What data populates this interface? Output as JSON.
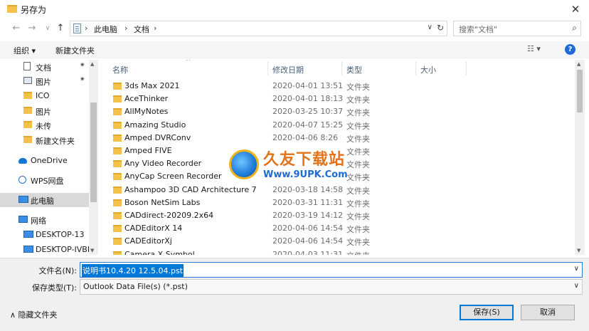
{
  "window": {
    "title": "另存为",
    "close_glyph": "✕"
  },
  "nav": {
    "back_glyph": "←",
    "forward_glyph": "→",
    "recent_glyph": "∨",
    "up_glyph": "↑"
  },
  "address": {
    "crumbs": [
      "此电脑",
      "文档"
    ],
    "sep_glyph": "›",
    "dropdown_glyph": "∨",
    "refresh_glyph": "↻"
  },
  "search": {
    "placeholder": "搜索\"文档\"",
    "icon_glyph": "⌕"
  },
  "toolbar": {
    "organize_label": "组织 ▾",
    "new_folder_label": "新建文件夹",
    "view_label": "☷ ▾",
    "help_label": "?"
  },
  "sidebar": {
    "items": [
      {
        "label": "文档",
        "icon": "document-icon",
        "pinned": true
      },
      {
        "label": "图片",
        "icon": "pictures-icon",
        "pinned": true
      },
      {
        "label": "ICO",
        "icon": "folder-icon",
        "pinned": false
      },
      {
        "label": "图片",
        "icon": "folder-icon",
        "pinned": false
      },
      {
        "label": "未传",
        "icon": "folder-icon",
        "pinned": false
      },
      {
        "label": "新建文件夹",
        "icon": "folder-icon",
        "pinned": false
      },
      {
        "label": "OneDrive",
        "icon": "cloud-icon",
        "pinned": false
      },
      {
        "label": "WPS网盘",
        "icon": "wps-cloud-icon",
        "pinned": false
      },
      {
        "label": "此电脑",
        "icon": "computer-icon",
        "pinned": false,
        "selected": true
      },
      {
        "label": "网络",
        "icon": "network-icon",
        "pinned": false
      },
      {
        "label": "DESKTOP-13",
        "icon": "computer-icon",
        "pinned": false
      },
      {
        "label": "DESKTOP-IVBL",
        "icon": "computer-icon",
        "pinned": false
      }
    ],
    "pin_glyph": "📌"
  },
  "columns": {
    "name": "名称",
    "modified": "修改日期",
    "type": "类型",
    "size": "大小",
    "sort_glyph": "^"
  },
  "files": [
    {
      "name": "3ds Max 2021",
      "date": "2020-04-01 13:51",
      "type": "文件夹"
    },
    {
      "name": "AceThinker",
      "date": "2020-04-01 18:13",
      "type": "文件夹"
    },
    {
      "name": "AllMyNotes",
      "date": "2020-03-25 10:37",
      "type": "文件夹"
    },
    {
      "name": "Amazing Studio",
      "date": "2020-04-07 15:25",
      "type": "文件夹"
    },
    {
      "name": "Amped DVRConv",
      "date": "2020-04-06 8:26",
      "type": "文件夹"
    },
    {
      "name": "Amped FIVE",
      "date": "",
      "type": "文件夹"
    },
    {
      "name": "Any Video Recorder",
      "date": "",
      "type": "文件夹"
    },
    {
      "name": "AnyCap Screen Recorder",
      "date": "",
      "type": "文件夹"
    },
    {
      "name": "Ashampoo 3D CAD Architecture 7",
      "date": "2020-03-18 14:58",
      "type": "文件夹"
    },
    {
      "name": "Boson NetSim Labs",
      "date": "2020-03-31 11:31",
      "type": "文件夹"
    },
    {
      "name": "CADdirect-20209.2x64",
      "date": "2020-03-19 14:12",
      "type": "文件夹"
    },
    {
      "name": "CADEditorX 14",
      "date": "2020-04-06 14:54",
      "type": "文件夹"
    },
    {
      "name": "CADEditorXj",
      "date": "2020-04-06 14:54",
      "type": "文件夹"
    },
    {
      "name": "Camera X Symbol",
      "date": "2020-04-03 11:31",
      "type": "文件夹"
    }
  ],
  "watermark": {
    "title": "久友下载站",
    "url": "Www.9UPK.Com",
    "faint": "WWW．9UPK．COM"
  },
  "form": {
    "filename_label": "文件名(N):",
    "filename_value": "说明书10.4.20 12.5.04.pst",
    "filetype_label": "保存类型(T):",
    "filetype_value": "Outlook Data File(s) (*.pst)",
    "dropdown_glyph": "∨",
    "hide_folders_label": "∧  隐藏文件夹",
    "save_label": "保存(S)",
    "cancel_label": "取消"
  }
}
